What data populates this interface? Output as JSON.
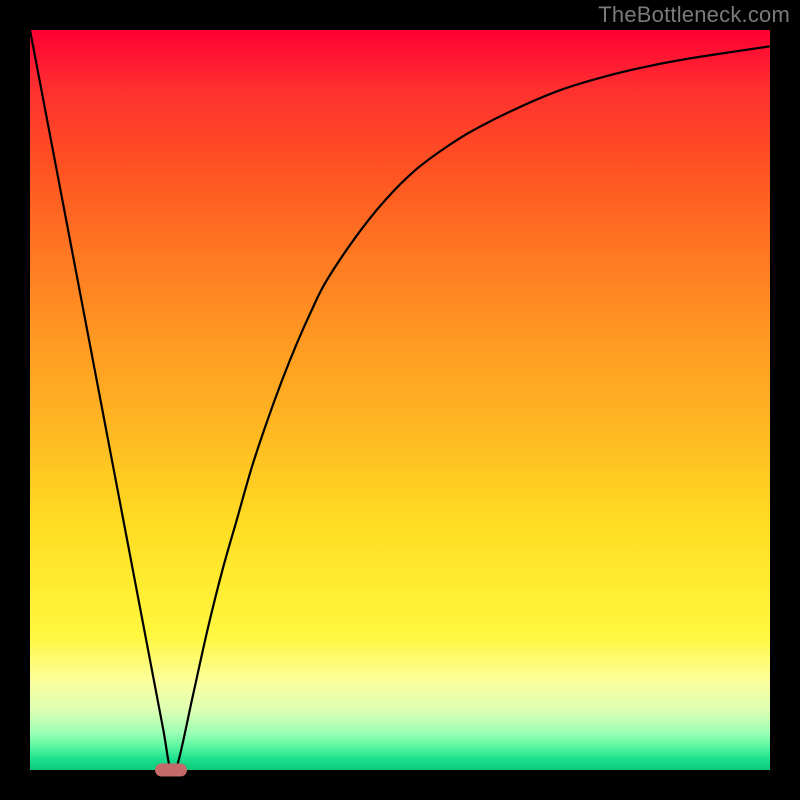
{
  "watermark": "TheBottleneck.com",
  "chart_data": {
    "type": "line",
    "title": "",
    "xlabel": "",
    "ylabel": "",
    "xlim": [
      0,
      100
    ],
    "ylim": [
      0,
      100
    ],
    "x": [
      0,
      2,
      4,
      6,
      8,
      10,
      12,
      14,
      16,
      18,
      19,
      20,
      22,
      24,
      26,
      28,
      30,
      32,
      34,
      36,
      38,
      40,
      44,
      48,
      52,
      56,
      60,
      66,
      72,
      78,
      84,
      90,
      96,
      100
    ],
    "values": [
      100,
      89.5,
      79,
      68.5,
      58,
      47.5,
      37,
      26.5,
      16,
      5.5,
      0,
      1,
      10,
      19,
      27,
      34,
      41,
      47,
      52.5,
      57.5,
      62,
      66,
      72,
      77,
      81,
      84,
      86.5,
      89.5,
      92,
      93.8,
      95.2,
      96.3,
      97.2,
      97.8
    ],
    "marker": {
      "x": 19,
      "y": 0
    },
    "background_gradient": "red-to-green vertical"
  }
}
